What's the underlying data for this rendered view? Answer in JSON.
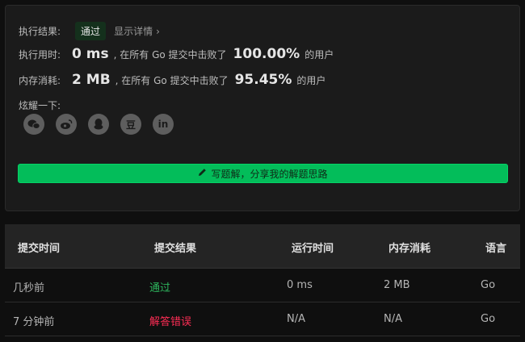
{
  "result": {
    "status_label": "执行结果:",
    "status_badge": "通过",
    "details_link": "显示详情",
    "details_chevron": "›",
    "runtime_label": "执行用时:",
    "runtime_value": "0 ms",
    "runtime_middle": ", 在所有 Go 提交中击败了",
    "runtime_percent": "100.00%",
    "runtime_suffix": "的用户",
    "memory_label": "内存消耗:",
    "memory_value": "2 MB",
    "memory_middle": ", 在所有 Go 提交中击败了",
    "memory_percent": "95.45%",
    "memory_suffix": "的用户",
    "share_label": "炫耀一下:",
    "share_icons": [
      "wechat-icon",
      "weibo-icon",
      "qq-icon",
      "douban-icon",
      "linkedin-icon"
    ],
    "douban_glyph": "豆",
    "linkedin_glyph": "in",
    "write_button": "写题解，分享我的解题思路"
  },
  "table": {
    "headers": [
      "提交时间",
      "提交结果",
      "运行时间",
      "内存消耗",
      "语言"
    ],
    "rows": [
      {
        "time": "几秒前",
        "result": "通过",
        "runtime": "0 ms",
        "memory": "2 MB",
        "lang": "Go"
      },
      {
        "time": "7 分钟前",
        "result": "解答错误",
        "runtime": "N/A",
        "memory": "N/A",
        "lang": "Go"
      }
    ]
  },
  "colors": {
    "accepted": "#2db55d",
    "wrong_answer": "#ff2d55",
    "button": "#03bd5a"
  }
}
